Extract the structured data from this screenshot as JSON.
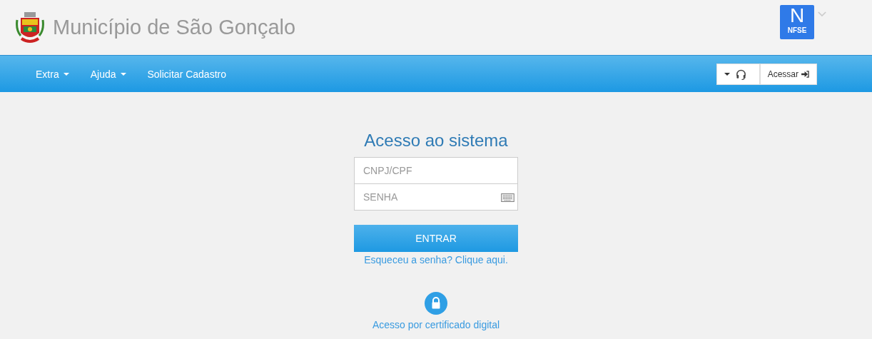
{
  "header": {
    "title": "Município de São Gonçalo",
    "badge": {
      "letter": "N",
      "label": "NFSE"
    }
  },
  "nav": {
    "items": [
      {
        "label": "Extra",
        "kind": "dropdown"
      },
      {
        "label": "Ajuda",
        "kind": "dropdown"
      },
      {
        "label": "Solicitar Cadastro",
        "kind": "link"
      }
    ],
    "access_button": "Acessar"
  },
  "login": {
    "title": "Acesso ao sistema",
    "fields": [
      {
        "placeholder": "CNPJ/CPF",
        "kind": "text"
      },
      {
        "placeholder": "SENHA",
        "kind": "password"
      }
    ],
    "submit": "ENTRAR",
    "forgot_link": "Esqueceu a senha? Clique aqui.",
    "certificate_link": "Acesso por certificado digital"
  }
}
